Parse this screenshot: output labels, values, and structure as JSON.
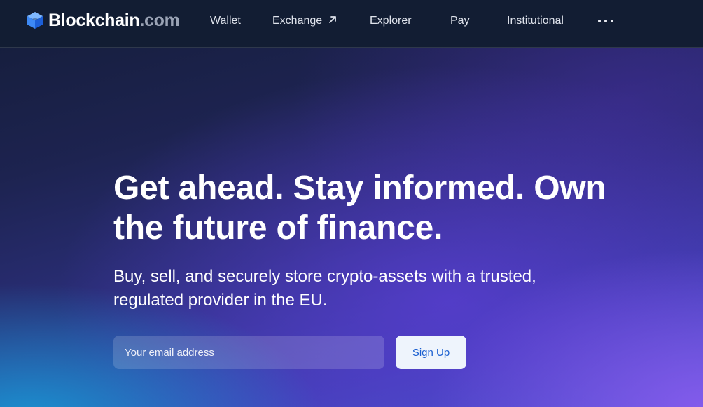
{
  "brand": {
    "name_main": "Blockchain",
    "name_suffix": ".com",
    "logo_icon": "blockchain-cube-icon",
    "accent_color": "#3d89f5"
  },
  "nav": {
    "items": [
      {
        "label": "Wallet"
      },
      {
        "label": "Exchange",
        "icon": "external-arrow-icon"
      },
      {
        "label": "Explorer"
      },
      {
        "label": "Pay"
      },
      {
        "label": "Institutional"
      }
    ],
    "more_icon": "more-dots-icon"
  },
  "hero": {
    "title": "Get ahead. Stay informed. Own the future of finance.",
    "subtitle": "Buy, sell, and securely store crypto-assets with a trusted, regulated provider in the EU.",
    "email_placeholder": "Your email address",
    "email_value": "",
    "signup_label": "Sign Up"
  },
  "colors": {
    "nav_background": "#121d33",
    "signup_text": "#1a5fd0",
    "signup_background": "#eef4fc"
  }
}
